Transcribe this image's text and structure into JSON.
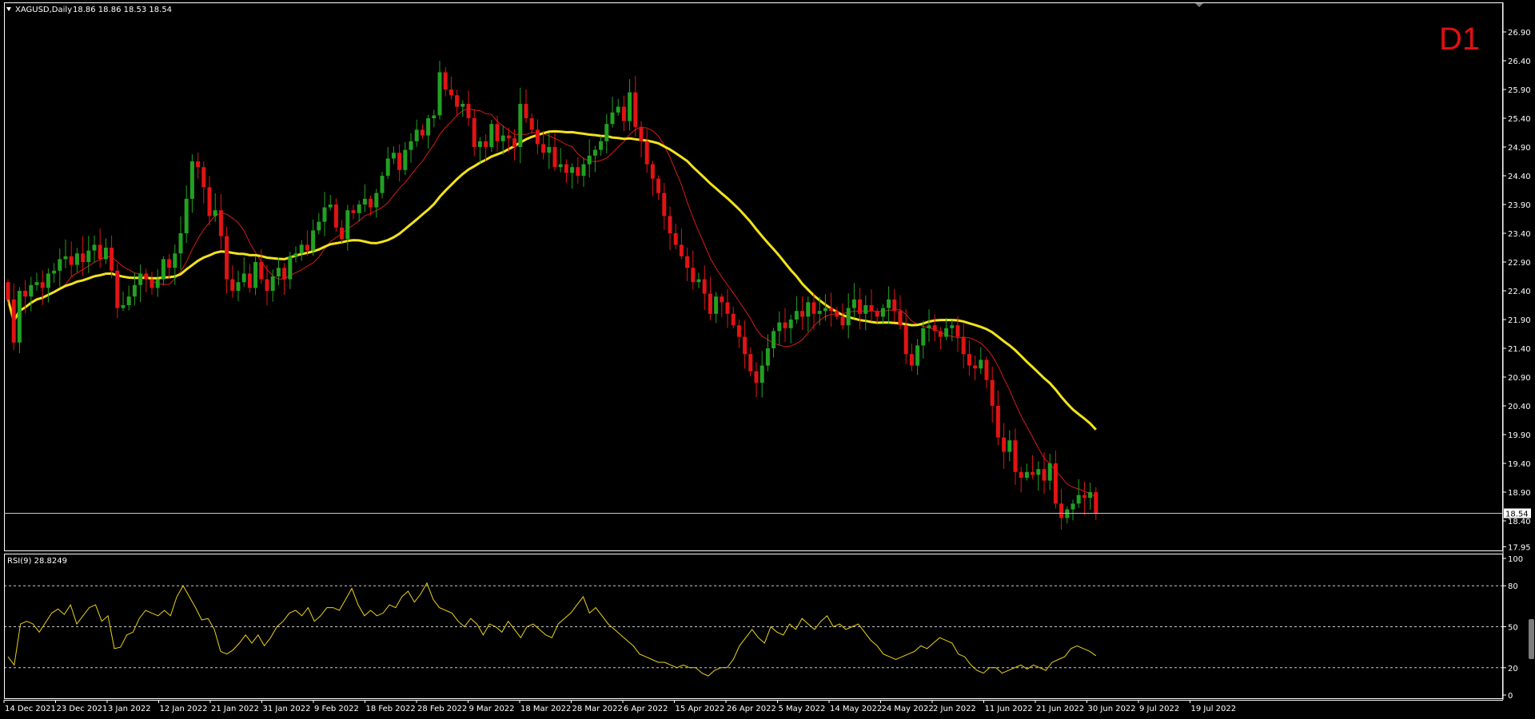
{
  "chart_data": [
    {
      "type": "candlestick",
      "symbol_header": "XAGUSD,Daily",
      "ohlc_header": "18.86 18.86 18.53 18.54",
      "timeframe_label": "D1",
      "current_price_label": "18.54",
      "current_price": 18.54,
      "y_ticks": [
        "26.90",
        "26.40",
        "25.90",
        "25.40",
        "24.90",
        "24.40",
        "23.90",
        "23.40",
        "22.90",
        "22.40",
        "21.90",
        "21.40",
        "20.90",
        "20.40",
        "19.90",
        "19.40",
        "18.90",
        "18.40",
        "17.95"
      ],
      "ylim": [
        17.95,
        27.0
      ],
      "x_ticks": [
        "14 Dec 2021",
        "23 Dec 2021",
        "3 Jan 2022",
        "12 Jan 2022",
        "21 Jan 2022",
        "31 Jan 2022",
        "9 Feb 2022",
        "18 Feb 2022",
        "28 Feb 2022",
        "9 Mar 2022",
        "18 Mar 2022",
        "28 Mar 2022",
        "6 Apr 2022",
        "15 Apr 2022",
        "26 Apr 2022",
        "5 May 2022",
        "14 May 2022",
        "24 May 2022",
        "2 Jun 2022",
        "11 Jun 2022",
        "21 Jun 2022",
        "30 Jun 2022",
        "9 Jul 2022",
        "19 Jul 2022"
      ],
      "colors": {
        "up": "#22a022",
        "down": "#e01414",
        "ma_fast": "#d41c1c",
        "ma_slow": "#f2e31b",
        "d1": "#e01010"
      },
      "closes": [
        22.25,
        21.5,
        22.4,
        22.3,
        22.5,
        22.55,
        22.45,
        22.7,
        22.75,
        22.95,
        23.0,
        22.85,
        23.05,
        22.9,
        23.1,
        23.2,
        22.95,
        23.15,
        22.75,
        22.1,
        22.15,
        22.3,
        22.5,
        22.7,
        22.6,
        22.45,
        22.6,
        22.95,
        22.8,
        23.05,
        23.4,
        24.0,
        24.65,
        24.55,
        24.2,
        23.7,
        23.8,
        23.35,
        22.6,
        22.4,
        22.55,
        22.7,
        22.45,
        22.9,
        22.6,
        22.4,
        22.65,
        22.8,
        22.6,
        23.0,
        23.05,
        23.2,
        23.1,
        23.45,
        23.6,
        23.85,
        23.9,
        23.5,
        23.3,
        23.8,
        23.75,
        23.9,
        24.0,
        23.85,
        24.1,
        24.4,
        24.7,
        24.8,
        24.5,
        24.85,
        25.0,
        25.2,
        25.1,
        25.4,
        25.45,
        26.2,
        25.9,
        25.8,
        25.6,
        25.65,
        25.4,
        24.9,
        25.0,
        24.9,
        25.3,
        25.0,
        25.1,
        25.05,
        24.9,
        25.65,
        25.4,
        25.2,
        24.95,
        24.8,
        24.9,
        24.55,
        24.6,
        24.45,
        24.55,
        24.4,
        24.6,
        24.75,
        24.85,
        25.0,
        25.3,
        25.5,
        25.6,
        25.35,
        25.85,
        25.25,
        25.0,
        24.6,
        24.35,
        24.1,
        23.7,
        23.4,
        23.2,
        23.0,
        22.8,
        22.55,
        22.6,
        22.35,
        22.0,
        22.3,
        22.2,
        22.0,
        21.8,
        21.6,
        21.3,
        21.0,
        20.8,
        21.1,
        21.4,
        21.7,
        21.85,
        21.75,
        21.9,
        22.05,
        21.95,
        22.2,
        22.0,
        22.05,
        22.1,
        22.05,
        21.95,
        21.8,
        22.1,
        22.25,
        22.0,
        22.15,
        22.05,
        21.95,
        22.1,
        22.25,
        22.05,
        21.8,
        21.3,
        21.1,
        21.45,
        21.75,
        21.8,
        21.7,
        21.6,
        21.75,
        21.8,
        21.6,
        21.3,
        21.1,
        21.05,
        21.2,
        20.85,
        20.4,
        19.85,
        19.6,
        19.8,
        19.25,
        19.15,
        19.25,
        19.2,
        19.3,
        19.1,
        19.4,
        18.7,
        18.45,
        18.6,
        18.7,
        18.85,
        18.8,
        18.9,
        18.54
      ],
      "ma_fast_label": "MA (red)",
      "ma_slow_label": "MA (yellow)"
    },
    {
      "type": "line",
      "indicator_header": "RSI(9) 28.8249",
      "y_ticks": [
        "100",
        "80",
        "50",
        "20",
        "0"
      ],
      "levels": [
        80,
        50,
        20
      ],
      "ylim": [
        0,
        100
      ],
      "color": "#ecd21c",
      "values": [
        28,
        22,
        52,
        54,
        52,
        46,
        53,
        60,
        63,
        59,
        66,
        52,
        58,
        64,
        66,
        54,
        58,
        34,
        35,
        44,
        46,
        56,
        62,
        60,
        58,
        62,
        58,
        72,
        80,
        72,
        64,
        55,
        56,
        48,
        32,
        30,
        33,
        38,
        44,
        38,
        44,
        36,
        42,
        50,
        54,
        60,
        62,
        58,
        64,
        54,
        58,
        64,
        64,
        62,
        70,
        78,
        66,
        58,
        62,
        58,
        60,
        66,
        64,
        72,
        76,
        68,
        74,
        82,
        70,
        64,
        62,
        60,
        54,
        50,
        56,
        52,
        44,
        52,
        50,
        46,
        54,
        48,
        42,
        50,
        52,
        48,
        44,
        42,
        52,
        56,
        60,
        66,
        72,
        60,
        64,
        58,
        52,
        48,
        44,
        40,
        36,
        30,
        28,
        26,
        24,
        24,
        22,
        20,
        22,
        20,
        20,
        16,
        14,
        18,
        20,
        20,
        26,
        36,
        42,
        48,
        42,
        38,
        50,
        46,
        44,
        52,
        48,
        56,
        52,
        48,
        54,
        58,
        50,
        52,
        48,
        50,
        52,
        46,
        40,
        36,
        30,
        28,
        26,
        28,
        30,
        32,
        36,
        34,
        38,
        42,
        40,
        38,
        30,
        28,
        22,
        18,
        16,
        20,
        20,
        16,
        18,
        20,
        22,
        19,
        22,
        20,
        18,
        24,
        26,
        28,
        34,
        36,
        34,
        32,
        28.8
      ]
    }
  ]
}
